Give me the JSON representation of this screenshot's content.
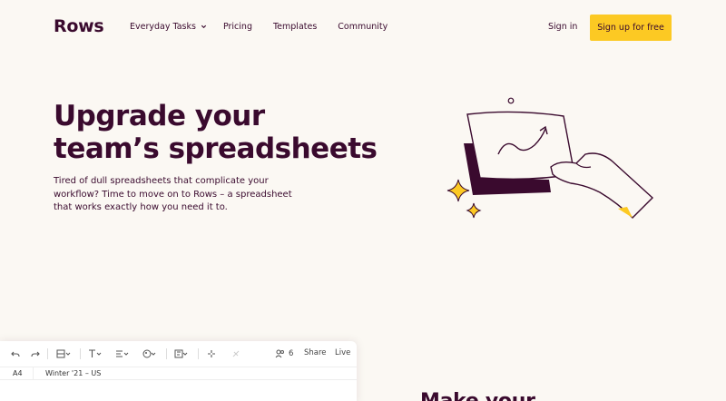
{
  "brand": {
    "logo": "Rows"
  },
  "nav": {
    "items": [
      {
        "label": "Everyday Tasks",
        "dropdown": true
      },
      {
        "label": "Pricing"
      },
      {
        "label": "Templates"
      },
      {
        "label": "Community"
      }
    ],
    "signin": "Sign in",
    "signup": "Sign up for free"
  },
  "hero": {
    "title_line1": "Upgrade your",
    "title_line2": "team’s spreadsheets",
    "subtitle": "Tired of dull spreadsheets that complicate your workflow? Time to move on to Rows – a spreadsheet that works exactly how you need it to."
  },
  "editor": {
    "collaborators": "6",
    "share": "Share",
    "live": "Live",
    "cell_ref": "A4",
    "cell_value": "Winter '21 – US",
    "icons": [
      "undo-icon",
      "redo-icon",
      "table-format-icon",
      "text-format-icon",
      "align-icon",
      "paint-icon",
      "insert-icon",
      "magic-icon",
      "clear-icon",
      "users-icon"
    ]
  },
  "section_peek": "Make your",
  "colors": {
    "brand": "#3a0a2e",
    "accent": "#fcc923",
    "background": "#fbf8f3"
  }
}
